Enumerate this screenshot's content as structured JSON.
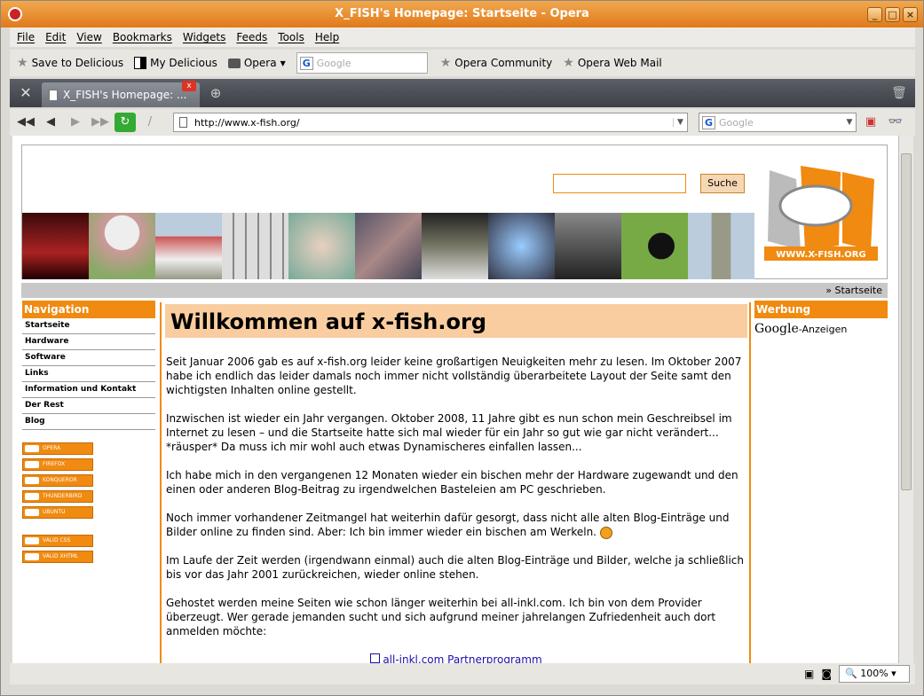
{
  "window": {
    "title": "X_FISH's Homepage: Startseite - Opera"
  },
  "menu": [
    "File",
    "Edit",
    "View",
    "Bookmarks",
    "Widgets",
    "Feeds",
    "Tools",
    "Help"
  ],
  "bookmarks": {
    "delicious": "Save to Delicious",
    "mydelicious": "My Delicious",
    "opera": "Opera",
    "search_placeholder": "Google",
    "community": "Opera Community",
    "webmail": "Opera Web Mail"
  },
  "tab": {
    "label": "X_FISH's Homepage: ..."
  },
  "address": {
    "url": "http://www.x-fish.org/",
    "search_placeholder": "Google"
  },
  "status": {
    "zoom": "100%"
  },
  "page": {
    "search_button": "Suche",
    "breadcrumb": "» Startseite",
    "nav_title": "Navigation",
    "nav_items": [
      "Startseite",
      "Hardware",
      "Software",
      "Links",
      "Information und Kontakt",
      "Der Rest",
      "Blog"
    ],
    "badges": [
      "OPERA",
      "FIREFOX",
      "KONQUEROR",
      "THUNDERBIRD",
      "UBUNTU",
      "VALID CSS",
      "VALID XHTML"
    ],
    "heading": "Willkommen auf x-fish.org",
    "paragraphs": [
      "Seit Januar 2006 gab es auf x-fish.org leider keine großartigen Neuigkeiten mehr zu lesen. Im Oktober 2007 habe ich endlich das leider damals noch immer nicht vollständig überarbeitete Layout der Seite samt den wichtigsten Inhalten online gestellt.",
      "Inzwischen ist wieder ein Jahr vergangen. Oktober 2008, 11 Jahre gibt es nun schon mein Geschreibsel im Internet zu lesen – und die Startseite hatte sich mal wieder für ein Jahr so gut wie gar nicht verändert... *räusper* Da muss ich mir wohl auch etwas Dynamischeres einfallen lassen...",
      "Ich habe mich in den vergangenen 12 Monaten wieder ein bischen mehr der Hardware zugewandt und den einen oder anderen Blog-Beitrag zu irgendwelchen Basteleien am PC geschrieben.",
      "Noch immer vorhandener Zeitmangel hat weiterhin dafür gesorgt, dass nicht alle alten Blog-Einträge und Bilder online zu finden sind. Aber: Ich bin immer wieder ein bischen am Werkeln.",
      "Im Laufe der Zeit werden (irgendwann einmal) auch die alten Blog-Einträge und Bilder, welche ja schließlich bis vor das Jahr 2001 zurückreichen, wieder online stehen.",
      "Gehostet werden meine Seiten wie schon länger weiterhin bei all-inkl.com. Ich bin von dem Provider überzeugt. Wer gerade jemanden sucht und sich aufgrund meiner jahrelangen Zufriedenheit auch dort anmelden möchte:"
    ],
    "partner_link": "all-inkl.com Partnerprogramm",
    "ads_title": "Werbung",
    "ads_google": "Google",
    "ads_label": "-Anzeigen",
    "logo_text": "WWW.X-FISH.ORG"
  }
}
